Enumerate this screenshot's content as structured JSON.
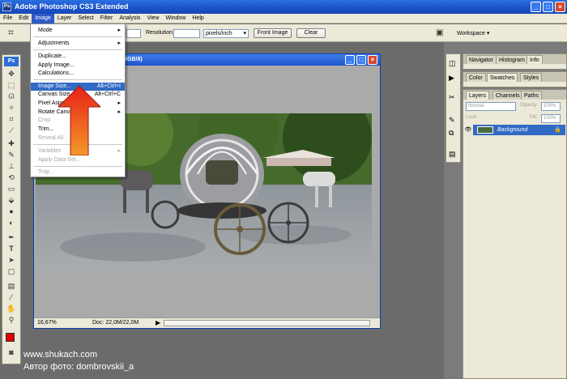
{
  "app": {
    "title": "Adobe Photoshop CS3 Extended",
    "logo": "Ps",
    "window_buttons": [
      "_",
      "□",
      "×"
    ]
  },
  "menubar": {
    "items": [
      "File",
      "Edit",
      "Image",
      "Layer",
      "Select",
      "Filter",
      "Analysis",
      "View",
      "Window",
      "Help"
    ],
    "active": "Image"
  },
  "options_bar": {
    "resolution_label": "Resolution:",
    "resolution_unit": "pixels/inch",
    "front_image_button": "Front Image",
    "clear_button": "Clear",
    "workspace_label": "Workspace ▾"
  },
  "image_menu": {
    "items": [
      {
        "label": "Mode",
        "submenu": true,
        "disabled": false
      },
      {
        "label": "Adjustments",
        "submenu": true,
        "disabled": false
      },
      {
        "label": "Duplicate...",
        "disabled": false
      },
      {
        "label": "Apply Image...",
        "disabled": false
      },
      {
        "label": "Calculations...",
        "disabled": false
      },
      {
        "label": "Image Size...",
        "shortcut": "Alt+Ctrl+I",
        "selected": true,
        "disabled": false
      },
      {
        "label": "Canvas Size...",
        "shortcut": "Alt+Ctrl+C",
        "disabled": false
      },
      {
        "label": "Pixel Aspect Ratio",
        "submenu": true,
        "disabled": false
      },
      {
        "label": "Rotate Canvas",
        "submenu": true,
        "disabled": false
      },
      {
        "label": "Crop",
        "disabled": true
      },
      {
        "label": "Trim...",
        "disabled": false
      },
      {
        "label": "Reveal All",
        "disabled": true
      },
      {
        "label": "Variables",
        "submenu": true,
        "disabled": true
      },
      {
        "label": "Apply Data Set...",
        "disabled": true
      },
      {
        "label": "Trap...",
        "disabled": true
      }
    ]
  },
  "document": {
    "title_suffix": "RGB/8)",
    "zoom": "16,67%",
    "doc_size": "Doc: 22,0M/22,0M"
  },
  "panels": {
    "navigator_tabs": [
      "Navigator",
      "Histogram",
      "Info"
    ],
    "swatches_tabs": [
      "Color",
      "Swatches",
      "Styles"
    ],
    "layers_tabs": [
      "Layers",
      "Channels",
      "Paths"
    ],
    "blend_mode": "Normal",
    "opacity_label": "Opacity:",
    "opacity_value": "100%",
    "lock_label": "Lock:",
    "fill_label": "Fill:",
    "fill_value": "100%",
    "layer_name": "Background"
  },
  "watermark": {
    "line1": "www.shukach.com",
    "line2": "Автор фото: dombrovskii_a"
  },
  "colors": {
    "accent": "#316ac5",
    "titlebar": "#1a52c8",
    "foreground": "#e00000",
    "arrow_top": "#e8201a",
    "arrow_bottom": "#f39a2a"
  }
}
